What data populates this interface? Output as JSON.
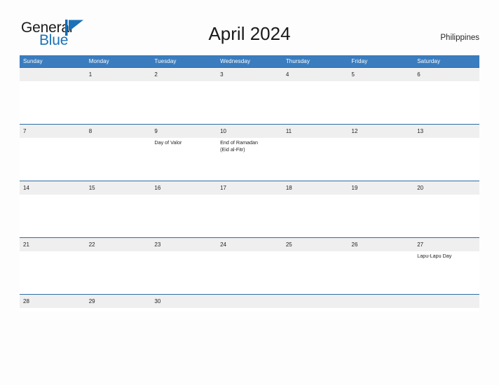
{
  "logo": {
    "word_one": "General",
    "word_two": "Blue",
    "mark_icon": "blue-flag-triangle-icon",
    "color_dark": "#1b1b1b",
    "color_blue": "#1b72b8"
  },
  "header": {
    "title": "April 2024",
    "country": "Philippines"
  },
  "colors": {
    "header_blue": "#3a7cbe",
    "row_border_blue": "#2e6ca4",
    "date_band_gray": "#efefef",
    "page_background": "#fdfdfd",
    "text_dark": "#232323"
  },
  "calendar": {
    "weekdays": [
      "Sunday",
      "Monday",
      "Tuesday",
      "Wednesday",
      "Thursday",
      "Friday",
      "Saturday"
    ],
    "weeks": [
      {
        "days": [
          {
            "date": "",
            "events": []
          },
          {
            "date": "1",
            "events": []
          },
          {
            "date": "2",
            "events": []
          },
          {
            "date": "3",
            "events": []
          },
          {
            "date": "4",
            "events": []
          },
          {
            "date": "5",
            "events": []
          },
          {
            "date": "6",
            "events": []
          }
        ]
      },
      {
        "days": [
          {
            "date": "7",
            "events": []
          },
          {
            "date": "8",
            "events": []
          },
          {
            "date": "9",
            "events": [
              "Day of Valor"
            ]
          },
          {
            "date": "10",
            "events": [
              "End of Ramadan",
              "(Eid al-Fitr)"
            ]
          },
          {
            "date": "11",
            "events": []
          },
          {
            "date": "12",
            "events": []
          },
          {
            "date": "13",
            "events": []
          }
        ]
      },
      {
        "days": [
          {
            "date": "14",
            "events": []
          },
          {
            "date": "15",
            "events": []
          },
          {
            "date": "16",
            "events": []
          },
          {
            "date": "17",
            "events": []
          },
          {
            "date": "18",
            "events": []
          },
          {
            "date": "19",
            "events": []
          },
          {
            "date": "20",
            "events": []
          }
        ]
      },
      {
        "days": [
          {
            "date": "21",
            "events": []
          },
          {
            "date": "22",
            "events": []
          },
          {
            "date": "23",
            "events": []
          },
          {
            "date": "24",
            "events": []
          },
          {
            "date": "25",
            "events": []
          },
          {
            "date": "26",
            "events": []
          },
          {
            "date": "27",
            "events": [
              "Lapu-Lapu Day"
            ]
          }
        ]
      },
      {
        "short": true,
        "days": [
          {
            "date": "28",
            "events": []
          },
          {
            "date": "29",
            "events": []
          },
          {
            "date": "30",
            "events": []
          },
          {
            "date": "",
            "events": []
          },
          {
            "date": "",
            "events": []
          },
          {
            "date": "",
            "events": []
          },
          {
            "date": "",
            "events": []
          }
        ]
      }
    ]
  }
}
